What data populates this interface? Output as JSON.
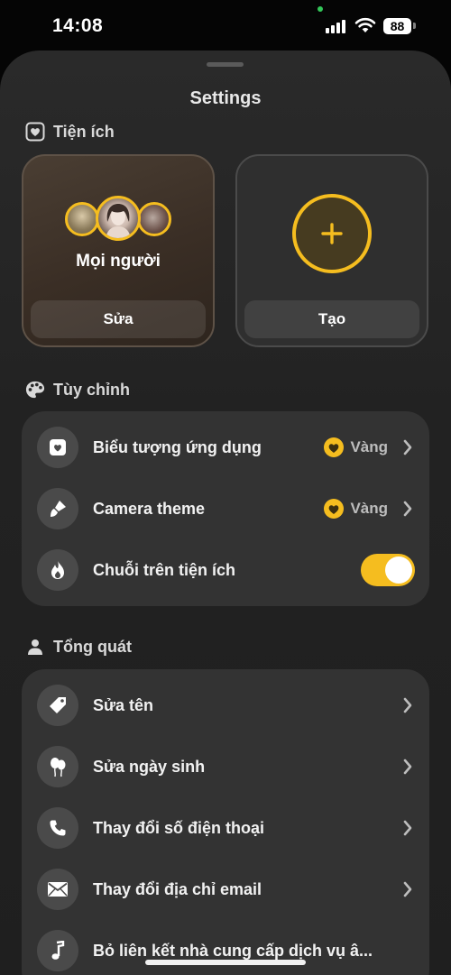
{
  "status_bar": {
    "time": "14:08",
    "battery": "88"
  },
  "sheet": {
    "title": "Settings"
  },
  "widgets_section": {
    "title": "Tiện ích",
    "people_widget": {
      "name": "Mọi người",
      "button": "Sửa"
    },
    "create_widget": {
      "button": "Tạo"
    }
  },
  "customize_section": {
    "title": "Tùy chỉnh",
    "items": [
      {
        "label": "Biểu tượng ứng dụng",
        "value": "Vàng"
      },
      {
        "label": "Camera theme",
        "value": "Vàng"
      },
      {
        "label": "Chuỗi trên tiện ích",
        "toggle_on": true
      }
    ]
  },
  "general_section": {
    "title": "Tổng quát",
    "items": [
      {
        "label": "Sửa tên"
      },
      {
        "label": "Sửa ngày sinh"
      },
      {
        "label": "Thay đổi số điện thoại"
      },
      {
        "label": "Thay đổi địa chỉ email"
      },
      {
        "label": "Bỏ liên kết nhà cung cấp dịch vụ â..."
      }
    ]
  },
  "colors": {
    "accent": "#f5bd1f",
    "group_bg": "#333333",
    "icon_bg": "#4a4a4a"
  }
}
